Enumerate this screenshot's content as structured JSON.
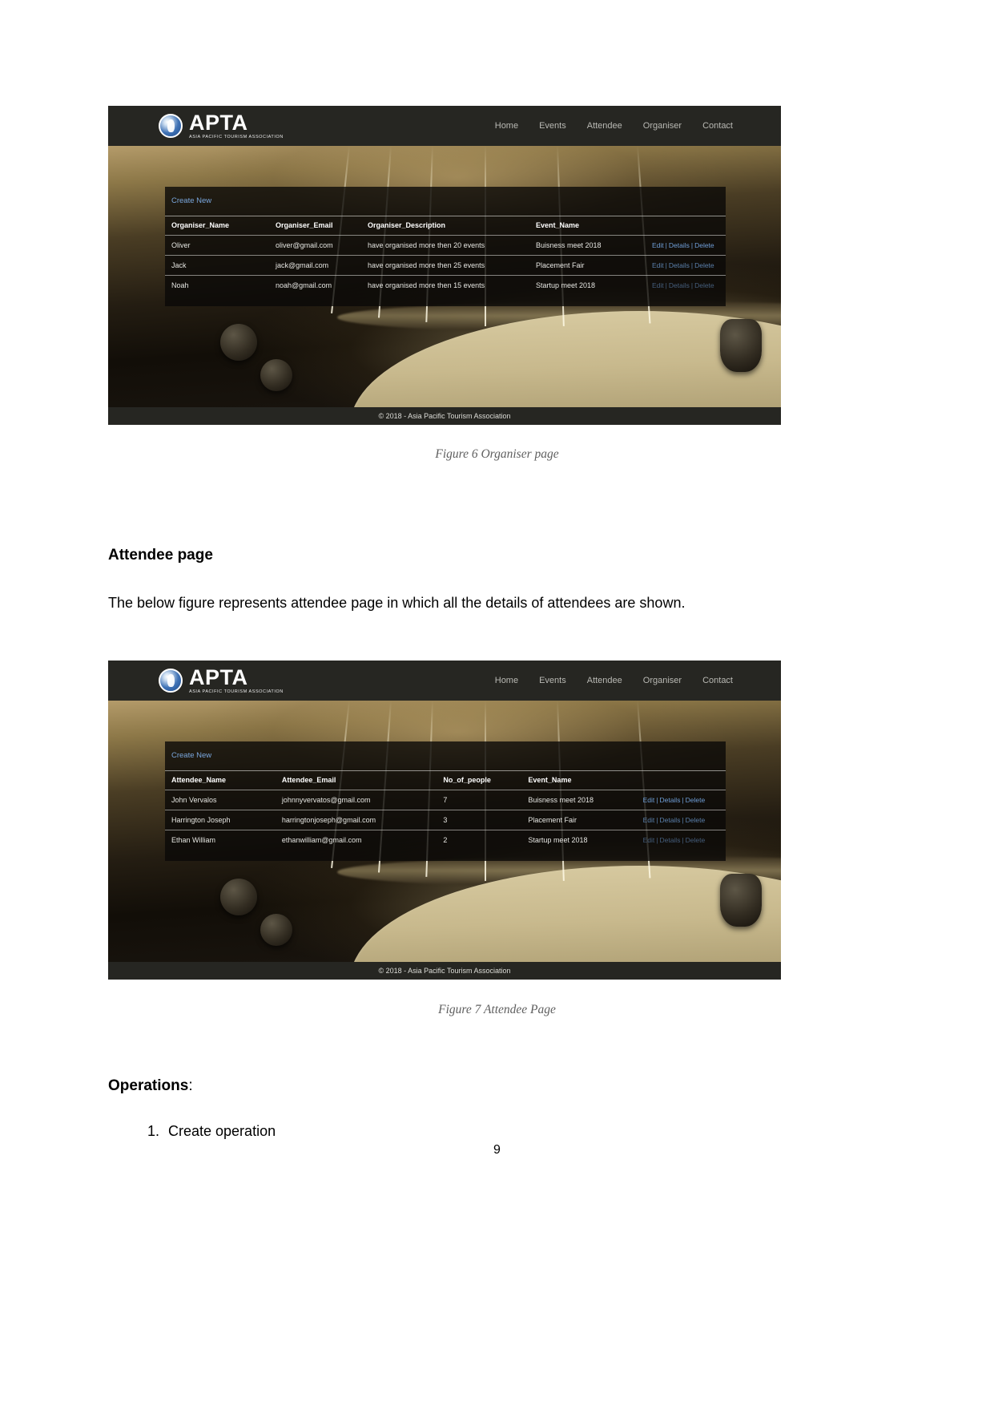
{
  "document": {
    "page_number": "9",
    "attendee_section": {
      "heading": "Attendee page",
      "paragraph": "The below figure represents attendee page in which all the details of attendees are shown."
    },
    "operations_section": {
      "heading": "Operations",
      "heading_suffix": ":",
      "items": [
        "Create operation"
      ]
    },
    "captions": {
      "figure6": "Figure 6 Organiser page",
      "figure7": "Figure 7 Attendee Page"
    }
  },
  "site": {
    "brand": {
      "name": "APTA",
      "tagline": "ASIA PACIFIC TOURISM ASSOCIATION",
      "logo_icon": "globe-figure-icon"
    },
    "nav": [
      {
        "label": "Home"
      },
      {
        "label": "Events"
      },
      {
        "label": "Attendee"
      },
      {
        "label": "Organiser"
      },
      {
        "label": "Contact"
      }
    ],
    "footer": "© 2018 - Asia Pacific Tourism Association",
    "create_new_label": "Create New",
    "row_actions": {
      "edit": "Edit",
      "details": "Details",
      "delete": "Delete",
      "separator": "|"
    },
    "colors": {
      "header_bg": "#262622",
      "link_blue": "#6f9fd8",
      "panel_bg": "rgba(10,9,7,0.80)",
      "text": "#e6e6e2"
    }
  },
  "organiser_page": {
    "columns": [
      "Organiser_Name",
      "Organiser_Email",
      "Organiser_Description",
      "Event_Name",
      ""
    ],
    "rows": [
      {
        "name": "Oliver",
        "email": "oliver@gmail.com",
        "description": "have organised more then 20 events",
        "event": "Buisness meet 2018"
      },
      {
        "name": "Jack",
        "email": "jack@gmail.com",
        "description": "have organised more then 25 events",
        "event": "Placement Fair"
      },
      {
        "name": "Noah",
        "email": "noah@gmail.com",
        "description": "have organised more then 15 events",
        "event": "Startup meet 2018"
      }
    ]
  },
  "attendee_page": {
    "columns": [
      "Attendee_Name",
      "Attendee_Email",
      "No_of_people",
      "Event_Name",
      ""
    ],
    "rows": [
      {
        "name": "John Vervalos",
        "email": "johnnyvervatos@gmail.com",
        "people": "7",
        "event": "Buisness meet 2018"
      },
      {
        "name": "Harrington Joseph",
        "email": "harringtonjoseph@gmail.com",
        "people": "3",
        "event": "Placement Fair"
      },
      {
        "name": "Ethan William",
        "email": "ethanwilliam@gmail.com",
        "people": "2",
        "event": "Startup meet 2018"
      }
    ]
  }
}
